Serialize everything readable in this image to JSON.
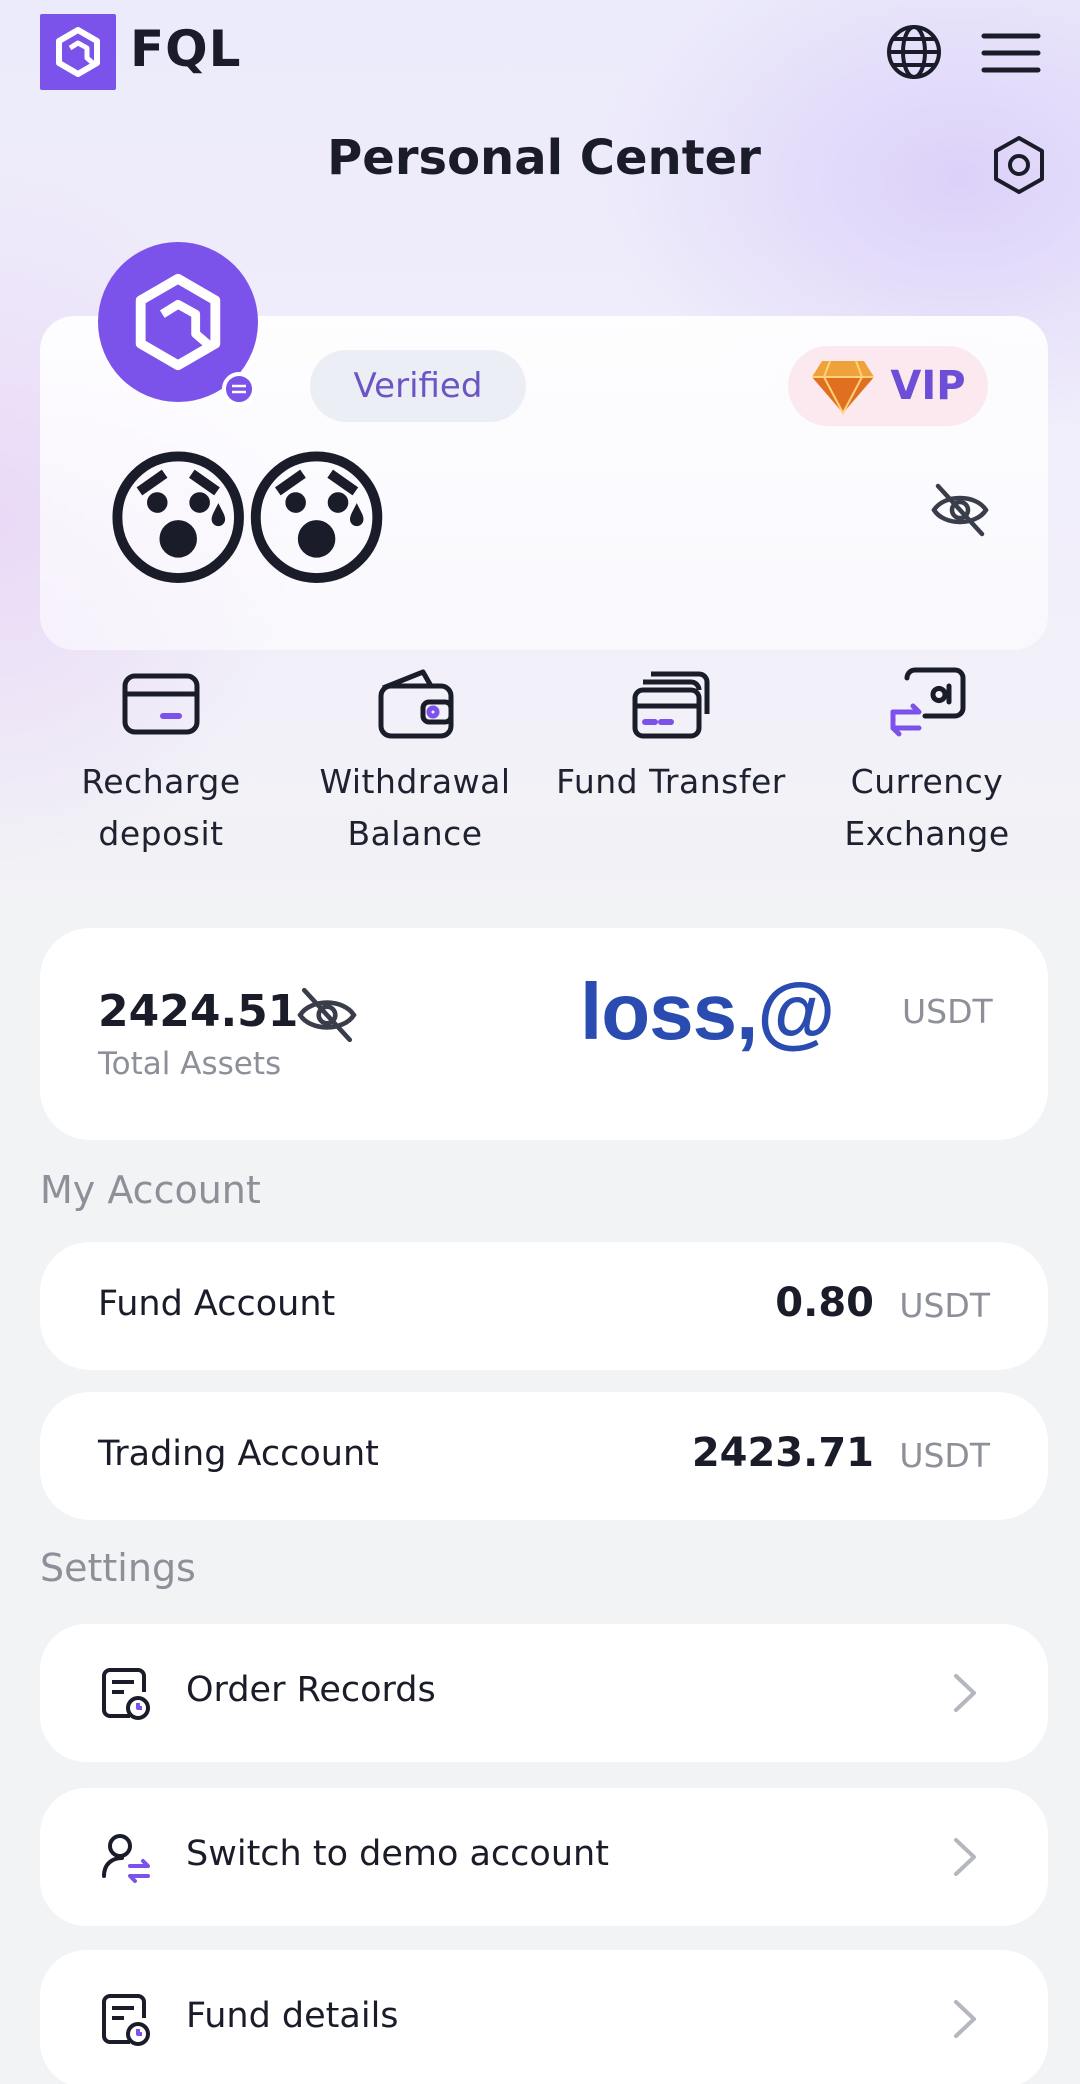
{
  "header": {
    "brand": "FQL",
    "title": "Personal Center",
    "icons": {
      "logo": "fql-logo-icon",
      "language": "globe-icon",
      "menu": "hamburger-menu-icon",
      "settings": "gear-icon"
    }
  },
  "profile": {
    "verified_label": "Verified",
    "vip_label": "VIP",
    "emoji_overlay": "😰😰"
  },
  "quick_actions": [
    {
      "line1": "Recharge",
      "line2": "deposit",
      "icon": "card-icon"
    },
    {
      "line1": "Withdrawal",
      "line2": "Balance",
      "icon": "wallet-icon"
    },
    {
      "line1": "Fund Transfer",
      "line2": "",
      "icon": "stacked-cards-icon"
    },
    {
      "line1": "Currency",
      "line2": "Exchange",
      "icon": "exchange-icon"
    }
  ],
  "assets": {
    "value": "2424.51",
    "label": "Total Assets",
    "unit": "USDT",
    "overlay_text": "loss,@"
  },
  "my_account": {
    "heading": "My Account",
    "accounts": [
      {
        "name": "Fund Account",
        "value": "0.80",
        "unit": "USDT"
      },
      {
        "name": "Trading Account",
        "value": "2423.71",
        "unit": "USDT"
      }
    ]
  },
  "settings": {
    "heading": "Settings",
    "items": [
      {
        "label": "Order Records",
        "icon": "order-records-icon"
      },
      {
        "label": "Switch to demo account",
        "icon": "user-switch-icon"
      },
      {
        "label": "Fund details",
        "icon": "fund-details-icon"
      }
    ]
  },
  "colors": {
    "accent": "#7b52ea",
    "overlay_text": "#2a4cb0",
    "muted": "#8d8f99"
  }
}
